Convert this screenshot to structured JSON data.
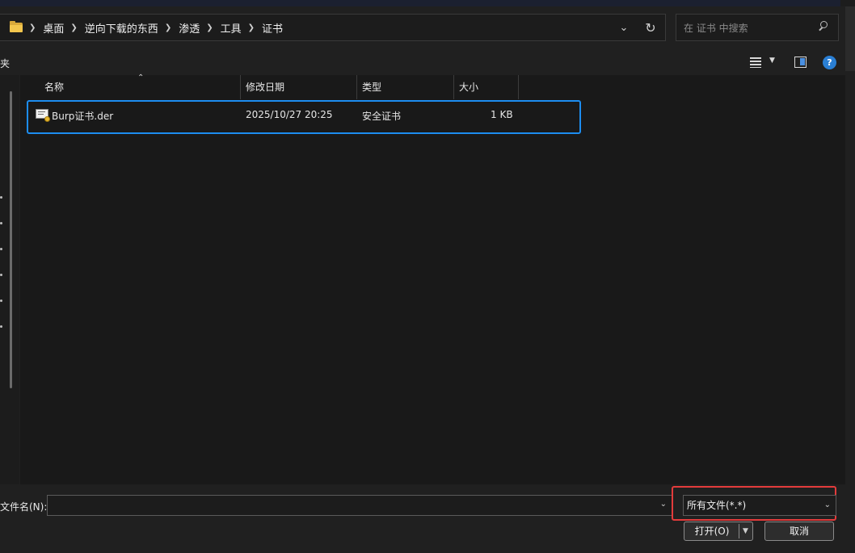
{
  "address": {
    "crumbs": [
      "桌面",
      "逆向下载的东西",
      "渗透",
      "工具",
      "证书"
    ]
  },
  "search": {
    "placeholder": "在 证书 中搜索"
  },
  "toolbar": {
    "partial_label": "夹"
  },
  "columns": {
    "name": "名称",
    "date": "修改日期",
    "type": "类型",
    "size": "大小"
  },
  "files": [
    {
      "name": "Burp证书.der",
      "date": "2025/10/27 20:25",
      "type": "安全证书",
      "size": "1 KB",
      "icon": "certificate-icon"
    }
  ],
  "bottom": {
    "filename_label": "文件名(N):",
    "filename_value": "",
    "filetype_value": "所有文件(*.*)",
    "open_label": "打开(O)",
    "cancel_label": "取消"
  },
  "colors": {
    "selection_outline": "#1d8df0",
    "filetype_highlight": "#e33b3b",
    "help_icon": "#2a7fd4"
  }
}
